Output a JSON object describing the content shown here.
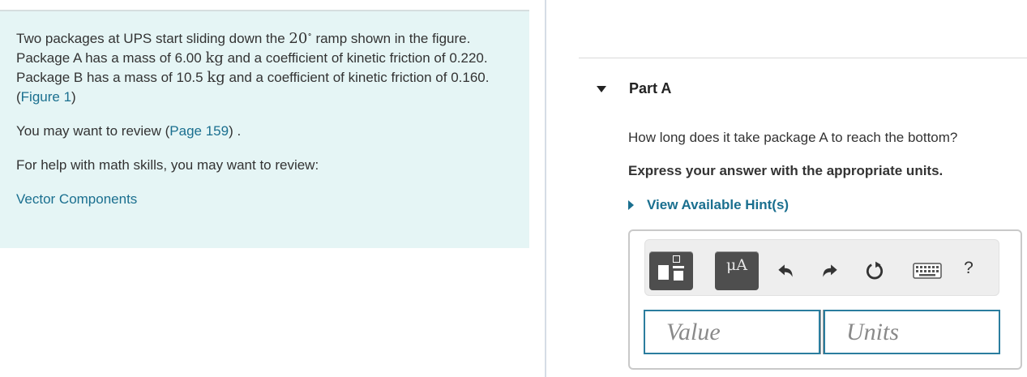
{
  "problem": {
    "text_1": "Two packages at UPS start sliding down the ",
    "angle": "20",
    "deg": "∘",
    "text_2": " ramp shown in the figure. Package A has a mass of 6.00 ",
    "unit_kg_a": "kg",
    "text_3": " and a coefficient of kinetic friction of 0.220. Package B has a mass of 10.5 ",
    "unit_kg_b": "kg",
    "text_4": " and a coefficient of kinetic friction of 0.160.",
    "figure_open": "(",
    "figure_link": "Figure 1",
    "figure_close": ")"
  },
  "review": {
    "prefix": "You may want to review (",
    "page_link": "Page 159",
    "suffix": ") ."
  },
  "math_help": {
    "text": "For help with math skills, you may want to review:",
    "link": "Vector Components"
  },
  "part": {
    "title": "Part A",
    "question": "How long does it take package A to reach the bottom?",
    "instructions": "Express your answer with the appropriate units.",
    "hint_label": "View Available Hint(s)"
  },
  "toolbar": {
    "units_label": "μA",
    "help_label": "?"
  },
  "answer": {
    "value_placeholder": "Value",
    "units_placeholder": "Units"
  },
  "colors": {
    "link": "#1a6f8f",
    "left_pane_bg": "#e5f5f5",
    "field_border": "#2b7d9e",
    "toolbar_button": "#4e4e4e"
  }
}
